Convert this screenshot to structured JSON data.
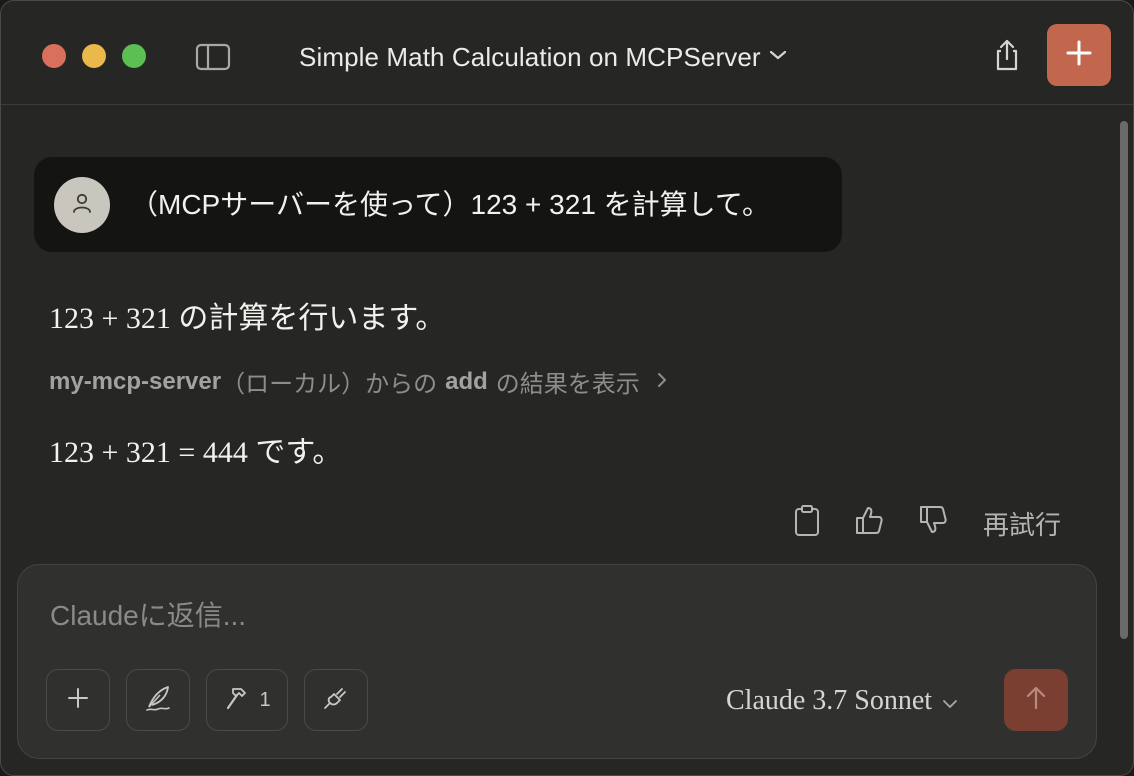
{
  "window": {
    "title": "Simple Math Calculation on MCPServer"
  },
  "colors": {
    "accent": "#c2664e",
    "background": "#262624",
    "user_bubble": "#141413",
    "send_disabled": "#7a3f31"
  },
  "icons": {
    "sidebar": "sidebar-toggle-icon",
    "share": "share-icon",
    "new_chat": "plus-icon",
    "user": "user-icon",
    "copy": "clipboard-icon",
    "like": "thumbs-up-icon",
    "dislike": "thumbs-down-icon",
    "attach": "plus-icon",
    "style": "feather-pen-icon",
    "tools": "hammer-icon",
    "integrations": "plug-icon",
    "send": "arrow-up-icon"
  },
  "conversation": {
    "user_message": "（MCPサーバーを使って）123 + 321 を計算して。",
    "assistant_intro": "123 + 321 の計算を行います。",
    "tool_use": {
      "server": "my-mcp-server",
      "scope": "（ローカル）からの",
      "tool": "add",
      "suffix": "の結果を表示"
    },
    "assistant_answer": "123 + 321 = 444 です。",
    "retry_label": "再試行"
  },
  "composer": {
    "placeholder": "Claudeに返信...",
    "value": "",
    "tools_count": "1",
    "model": "Claude 3.7 Sonnet"
  }
}
